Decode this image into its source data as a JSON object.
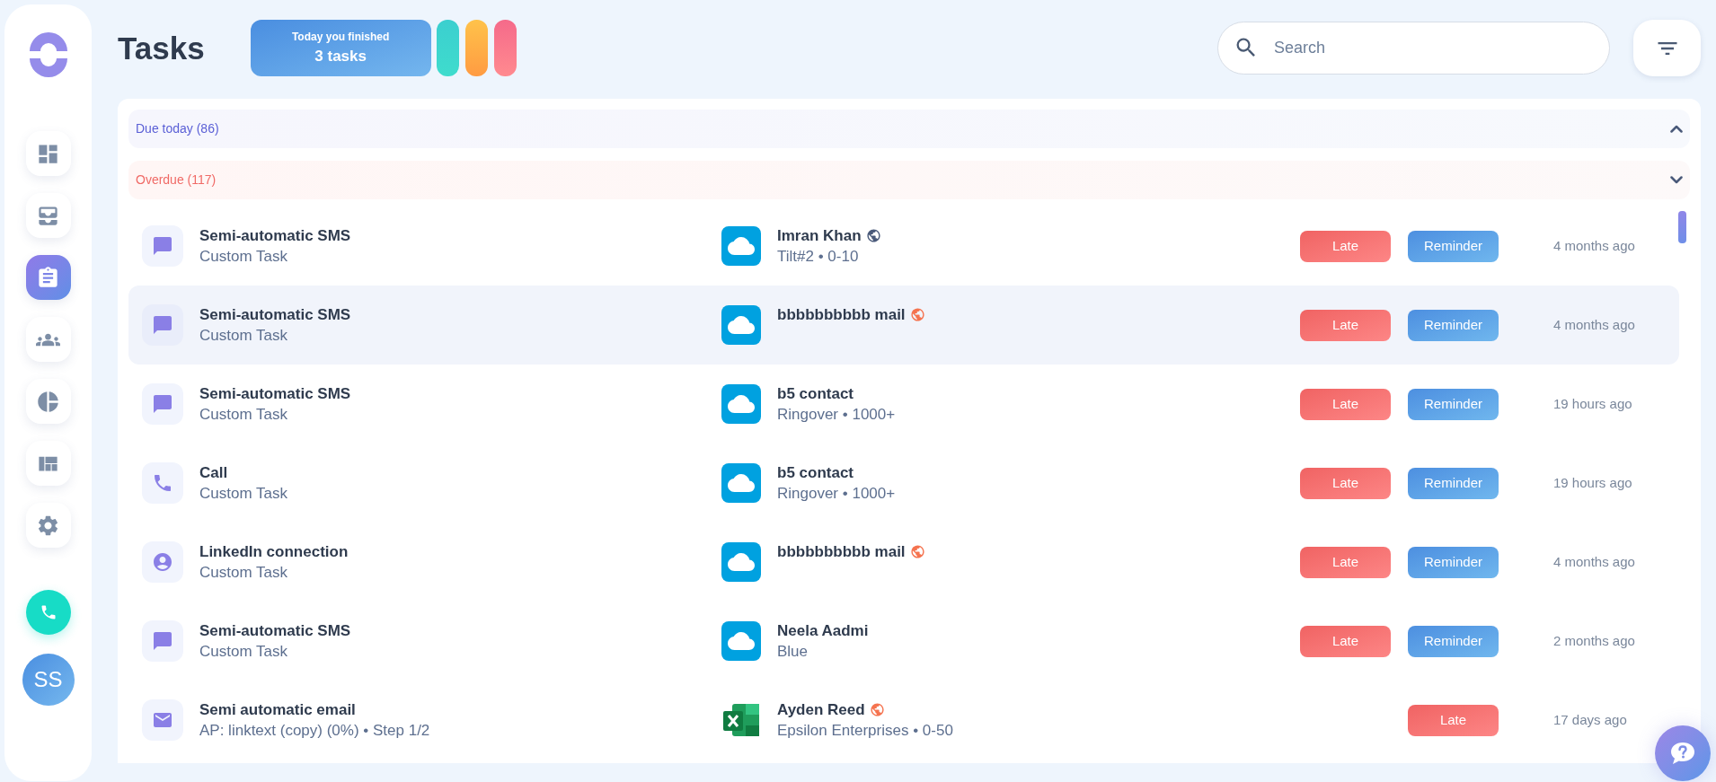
{
  "nav": [
    {
      "kind": "dashboard",
      "selected": false
    },
    {
      "kind": "stack",
      "selected": false
    },
    {
      "kind": "tasks",
      "selected": true
    },
    {
      "kind": "people",
      "selected": false
    },
    {
      "kind": "pie",
      "selected": false
    },
    {
      "kind": "layout",
      "selected": false
    },
    {
      "kind": "settings",
      "selected": false
    }
  ],
  "avatar": "SS",
  "header": {
    "title": "Tasks",
    "stats": {
      "caption": "Today you finished",
      "value": "3 tasks"
    },
    "search": {
      "placeholder": "Search"
    }
  },
  "sections": [
    {
      "label": "Due today (86)",
      "kind": "due",
      "expanded": true
    },
    {
      "label": "Overdue (117)",
      "kind": "overdue",
      "expanded": false
    }
  ],
  "rows": [
    {
      "kind": "sms",
      "title": "Semi-automatic SMS",
      "subtitle": "Custom Task",
      "contact": {
        "kind": "salesforce",
        "name": "Imran Khan",
        "globe": {
          "color": "#4a5a7a"
        },
        "detail": "Tilt#2 • 0-10"
      },
      "badges": [
        {
          "kind": "late",
          "label": "Late"
        },
        {
          "kind": "reminder",
          "label": "Reminder"
        }
      ],
      "time": "4 months ago",
      "selected": false
    },
    {
      "kind": "sms",
      "title": "Semi-automatic SMS",
      "subtitle": "Custom Task",
      "contact": {
        "kind": "salesforce",
        "name": "bbbbbbbbbb mail",
        "globe": {
          "color": "#f5734f"
        }
      },
      "badges": [
        {
          "kind": "late",
          "label": "Late"
        },
        {
          "kind": "reminder",
          "label": "Reminder"
        }
      ],
      "time": "4 months ago",
      "selected": true
    },
    {
      "kind": "sms",
      "title": "Semi-automatic SMS",
      "subtitle": "Custom Task",
      "contact": {
        "kind": "salesforce",
        "name": "b5 contact",
        "detail": "Ringover • 1000+"
      },
      "badges": [
        {
          "kind": "late",
          "label": "Late"
        },
        {
          "kind": "reminder",
          "label": "Reminder"
        }
      ],
      "time": "19 hours ago",
      "selected": false
    },
    {
      "kind": "call",
      "title": "Call",
      "subtitle": "Custom Task",
      "contact": {
        "kind": "salesforce",
        "name": "b5 contact",
        "detail": "Ringover • 1000+"
      },
      "badges": [
        {
          "kind": "late",
          "label": "Late"
        },
        {
          "kind": "reminder",
          "label": "Reminder"
        }
      ],
      "time": "19 hours ago",
      "selected": false
    },
    {
      "kind": "linkedin",
      "title": "LinkedIn connection",
      "subtitle": "Custom Task",
      "contact": {
        "kind": "salesforce",
        "name": "bbbbbbbbbb mail",
        "globe": {
          "color": "#f5734f"
        }
      },
      "badges": [
        {
          "kind": "late",
          "label": "Late"
        },
        {
          "kind": "reminder",
          "label": "Reminder"
        }
      ],
      "time": "4 months ago",
      "selected": false
    },
    {
      "kind": "sms",
      "title": "Semi-automatic SMS",
      "subtitle": "Custom Task",
      "contact": {
        "kind": "salesforce",
        "name": "Neela Aadmi",
        "detail": "Blue"
      },
      "badges": [
        {
          "kind": "late",
          "label": "Late"
        },
        {
          "kind": "reminder",
          "label": "Reminder"
        }
      ],
      "time": "2 months ago",
      "selected": false
    },
    {
      "kind": "email",
      "title": "Semi automatic email",
      "subtitle": "AP: linktext (copy) (0%) • Step 1/2",
      "contact": {
        "kind": "excel",
        "name": "Ayden Reed",
        "globe": {
          "color": "#f5734f"
        },
        "detail": "Epsilon Enterprises • 0-50"
      },
      "badges": [
        {
          "kind": "late",
          "label": "Late"
        }
      ],
      "time": "17 days ago",
      "selected": false
    }
  ]
}
